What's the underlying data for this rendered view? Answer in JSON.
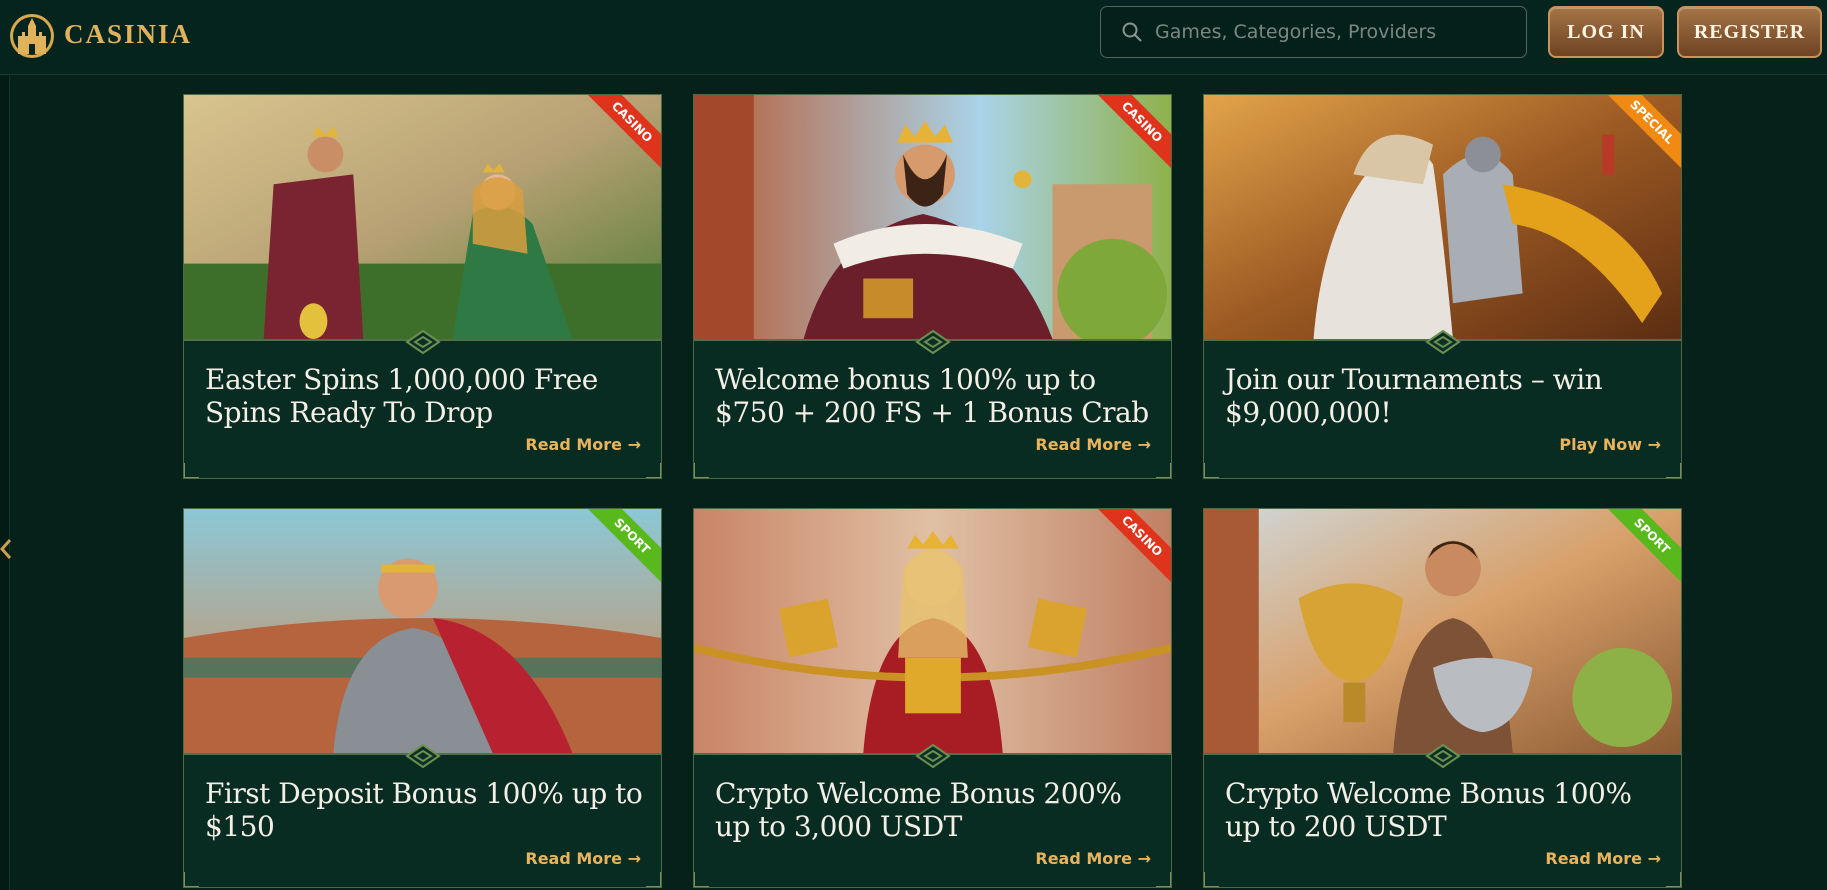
{
  "header": {
    "brand": "CASINIA",
    "search_placeholder": "Games, Categories, Providers",
    "login_label": "LOG IN",
    "register_label": "REGISTER"
  },
  "colors": {
    "background": "#06201a",
    "card": "#082b22",
    "gold": "#e0b25c",
    "casino_ribbon": "#e0331c",
    "special_ribbon": "#f08a12",
    "sport_ribbon": "#58b81c"
  },
  "promos": [
    {
      "title": "Easter Spins  1,000,000 Free Spins Ready To Drop",
      "link": "Read More →",
      "tag": "CASINO"
    },
    {
      "title": "Welcome bonus 100% up to $750 + 200 FS + 1 Bonus Crab",
      "link": "Read More →",
      "tag": "CASINO"
    },
    {
      "title": "Join our Tournaments – win $9,000,000!",
      "link": "Play Now →",
      "tag": "SPECIAL"
    },
    {
      "title": "First Deposit Bonus 100% up to $150",
      "link": "Read More →",
      "tag": "SPORT"
    },
    {
      "title": "Crypto Welcome Bonus 200% up to 3,000 USDT",
      "link": "Read More →",
      "tag": "CASINO"
    },
    {
      "title": "Crypto Welcome Bonus 100% up to 200 USDT",
      "link": "Read More →",
      "tag": "SPORT"
    }
  ]
}
